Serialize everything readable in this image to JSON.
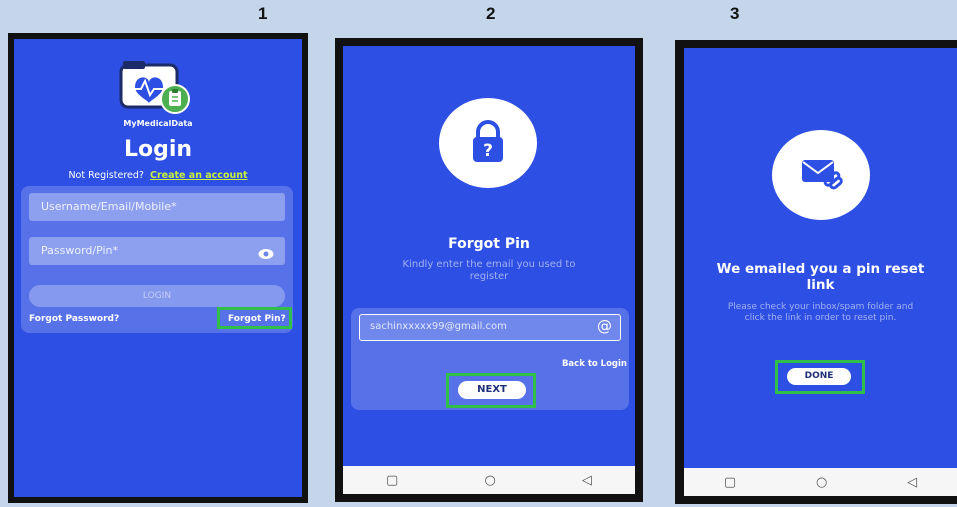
{
  "steps": [
    "1",
    "2",
    "3"
  ],
  "screen1": {
    "brand": "MyMedicalData",
    "title": "Login",
    "not_registered": "Not Registered?",
    "create_account": "Create an account",
    "username_placeholder": "Username/Email/Mobile*",
    "password_placeholder": "Password/Pin*",
    "login_button": "LOGIN",
    "forgot_password": "Forgot Password?",
    "forgot_pin": "Forgot Pin?"
  },
  "screen2": {
    "title": "Forgot Pin",
    "subtitle": "Kindly enter the email you used to register",
    "email_value": "sachinxxxxx99@gmail.com",
    "back_to_login": "Back to Login",
    "next_button": "NEXT"
  },
  "screen3": {
    "title": "We emailed you a pin reset link",
    "message": "Please check your inbox/spam folder and click the link in order to reset pin.",
    "done_button": "DONE"
  },
  "navbar": {
    "square": "▢",
    "circle": "○",
    "back": "◁"
  },
  "colors": {
    "screen_bg": "#2d4fe3",
    "highlight": "#2fbf4a",
    "link": "#c6f23a",
    "page_bg": "#c5d6ea"
  }
}
